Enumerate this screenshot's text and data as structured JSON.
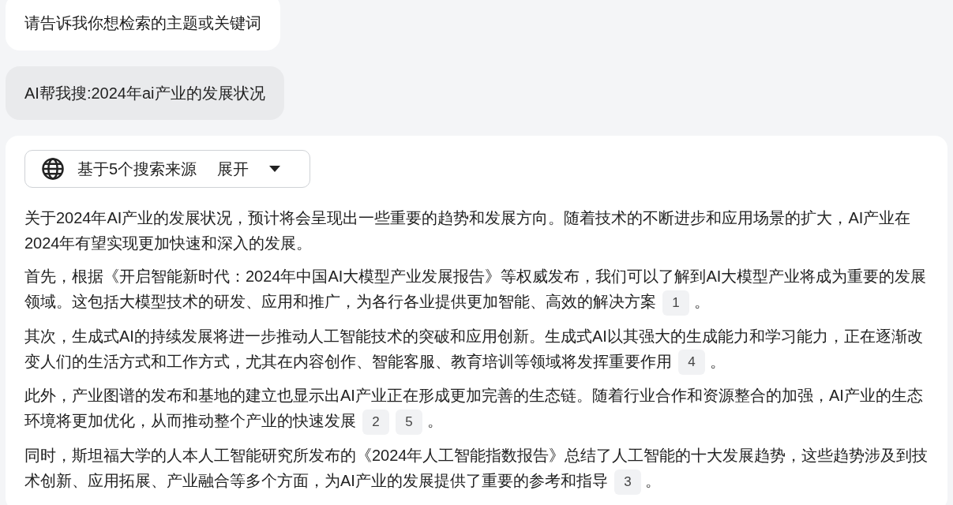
{
  "messages": [
    {
      "kind": "assistant",
      "text": "请告诉我你想检索的主题或关键词"
    },
    {
      "kind": "user",
      "text": "AI帮我搜:2024年ai产业的发展状况"
    }
  ],
  "answer": {
    "sources": {
      "label": "基于5个搜索来源",
      "toggle": "展开",
      "expanded": false
    },
    "paragraphs": [
      {
        "text": "关于2024年AI产业的发展状况，预计将会呈现出一些重要的趋势和发展方向。随着技术的不断进步和应用场景的扩大，AI产业在2024年有望实现更加快速和深入的发展。"
      },
      {
        "text": "首先，根据《开启智能新时代：2024年中国AI大模型产业发展报告》等权威发布，我们可以了解到AI大模型产业将成为重要的发展领域。这包括大模型技术的研发、应用和推广，为各行各业提供更加智能、高效的解决方案",
        "citations": [
          "1"
        ],
        "end": "。"
      },
      {
        "text": "其次，生成式AI的持续发展将进一步推动人工智能技术的突破和应用创新。生成式AI以其强大的生成能力和学习能力，正在逐渐改变人们的生活方式和工作方式，尤其在内容创作、智能客服、教育培训等领域将发挥重要作用",
        "citations": [
          "4"
        ],
        "end": "。"
      },
      {
        "text": "此外，产业图谱的发布和基地的建立也显示出AI产业正在形成更加完善的生态链。随着行业合作和资源整合的加强，AI产业的生态环境将更加优化，从而推动整个产业的快速发展",
        "citations": [
          "2",
          "5"
        ],
        "end": "。"
      },
      {
        "text": "同时，斯坦福大学的人本人工智能研究所发布的《2024年人工智能指数报告》总结了人工智能的十大发展趋势，这些趋势涉及到技术创新、应用拓展、产业融合等多个方面，为AI产业的发展提供了重要的参考和指导",
        "citations": [
          "3"
        ],
        "end": "。"
      }
    ]
  }
}
